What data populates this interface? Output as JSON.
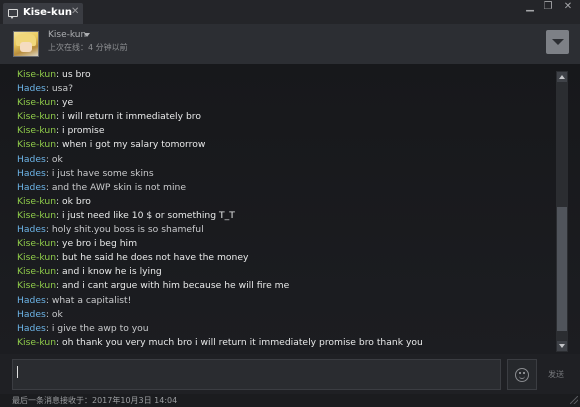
{
  "window": {
    "tab_title": "Kise-kun",
    "tab_close": "✕",
    "minimize": "▁",
    "maximize": "❐",
    "close": "✕"
  },
  "header": {
    "username": "Kise-kun",
    "status": "上次在线：4 分钟以前"
  },
  "messages": [
    {
      "sender": "Kise-kun",
      "role": "kise",
      "text": ": us bro"
    },
    {
      "sender": "Hades",
      "role": "hades",
      "text": ": usa?"
    },
    {
      "sender": "Kise-kun",
      "role": "kise",
      "text": ": ye"
    },
    {
      "sender": "Kise-kun",
      "role": "kise",
      "text": ": i will return it immediately bro"
    },
    {
      "sender": "Kise-kun",
      "role": "kise",
      "text": ": i promise"
    },
    {
      "sender": "Kise-kun",
      "role": "kise",
      "text": ": when i got my salary tomorrow"
    },
    {
      "sender": "Hades",
      "role": "hades",
      "text": ": ok"
    },
    {
      "sender": "Hades",
      "role": "hades",
      "text": ": i just have some skins"
    },
    {
      "sender": "Hades",
      "role": "hades",
      "text": ": and the AWP skin is not mine"
    },
    {
      "sender": "Kise-kun",
      "role": "kise",
      "text": ": ok bro"
    },
    {
      "sender": "Kise-kun",
      "role": "kise",
      "text": ": i just need like 10 $ or something T_T"
    },
    {
      "sender": "Hades",
      "role": "hades",
      "text": ": holy shit.you boss is so shameful"
    },
    {
      "sender": "Kise-kun",
      "role": "kise",
      "text": ": ye bro i beg him"
    },
    {
      "sender": "Kise-kun",
      "role": "kise",
      "text": ": but he said he does not have the money"
    },
    {
      "sender": "Kise-kun",
      "role": "kise",
      "text": ": and i know he is lying"
    },
    {
      "sender": "Kise-kun",
      "role": "kise",
      "text": ": and i cant argue with him because he will fire me"
    },
    {
      "sender": "Hades",
      "role": "hades",
      "text": ": what a capitalist!"
    },
    {
      "sender": "Hades",
      "role": "hades",
      "text": ": ok"
    },
    {
      "sender": "Hades",
      "role": "hades",
      "text": ": i give the awp to you"
    },
    {
      "sender": "Kise-kun",
      "role": "kise",
      "text": ": oh thank you very much bro i will return it immediately promise bro thank you"
    }
  ],
  "composer": {
    "send_label": "发送"
  },
  "footer": {
    "last_message": "最后一条消息接收于：2017年10月3日 14:04"
  },
  "colors": {
    "kise_name": "#8fcb4a",
    "hades_name": "#6cb3e6",
    "background": "#1b1c1f"
  }
}
